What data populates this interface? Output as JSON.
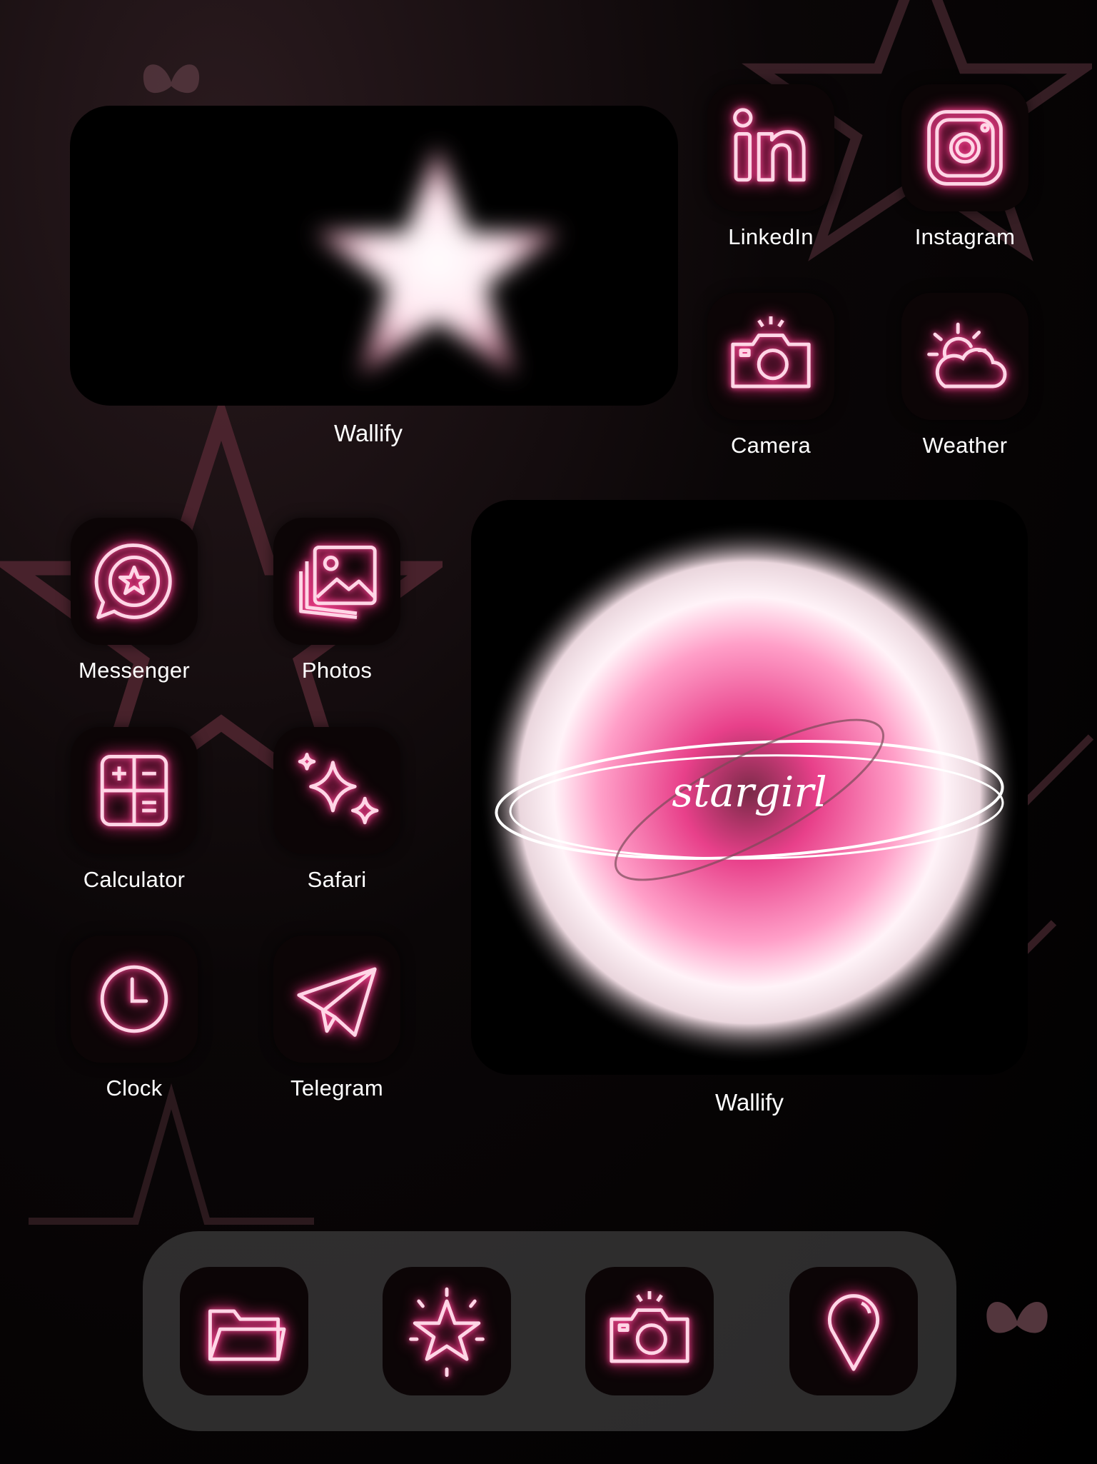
{
  "colors": {
    "neon_pink": "#ff4f9a",
    "neon_core": "#ffe3ef",
    "tile_bg": "#0c0506",
    "dock_bg": "#505050"
  },
  "widgets": [
    {
      "label": "Wallify",
      "icon": "glowing-star"
    },
    {
      "label": "Wallify",
      "icon": "glowing-orb",
      "text": "stargirl"
    }
  ],
  "apps": [
    {
      "label": "LinkedIn",
      "icon": "linkedin-icon"
    },
    {
      "label": "Instagram",
      "icon": "instagram-icon"
    },
    {
      "label": "Camera",
      "icon": "camera-icon"
    },
    {
      "label": "Weather",
      "icon": "weather-icon"
    },
    {
      "label": "Messenger",
      "icon": "messenger-icon"
    },
    {
      "label": "Photos",
      "icon": "photos-icon"
    },
    {
      "label": "Calculator",
      "icon": "calculator-icon"
    },
    {
      "label": "Safari",
      "icon": "sparkles-icon"
    },
    {
      "label": "Clock",
      "icon": "clock-icon"
    },
    {
      "label": "Telegram",
      "icon": "paper-plane-icon"
    }
  ],
  "dock": [
    {
      "icon": "folder-icon"
    },
    {
      "icon": "star-icon"
    },
    {
      "icon": "camera-icon"
    },
    {
      "icon": "map-pin-icon"
    }
  ]
}
